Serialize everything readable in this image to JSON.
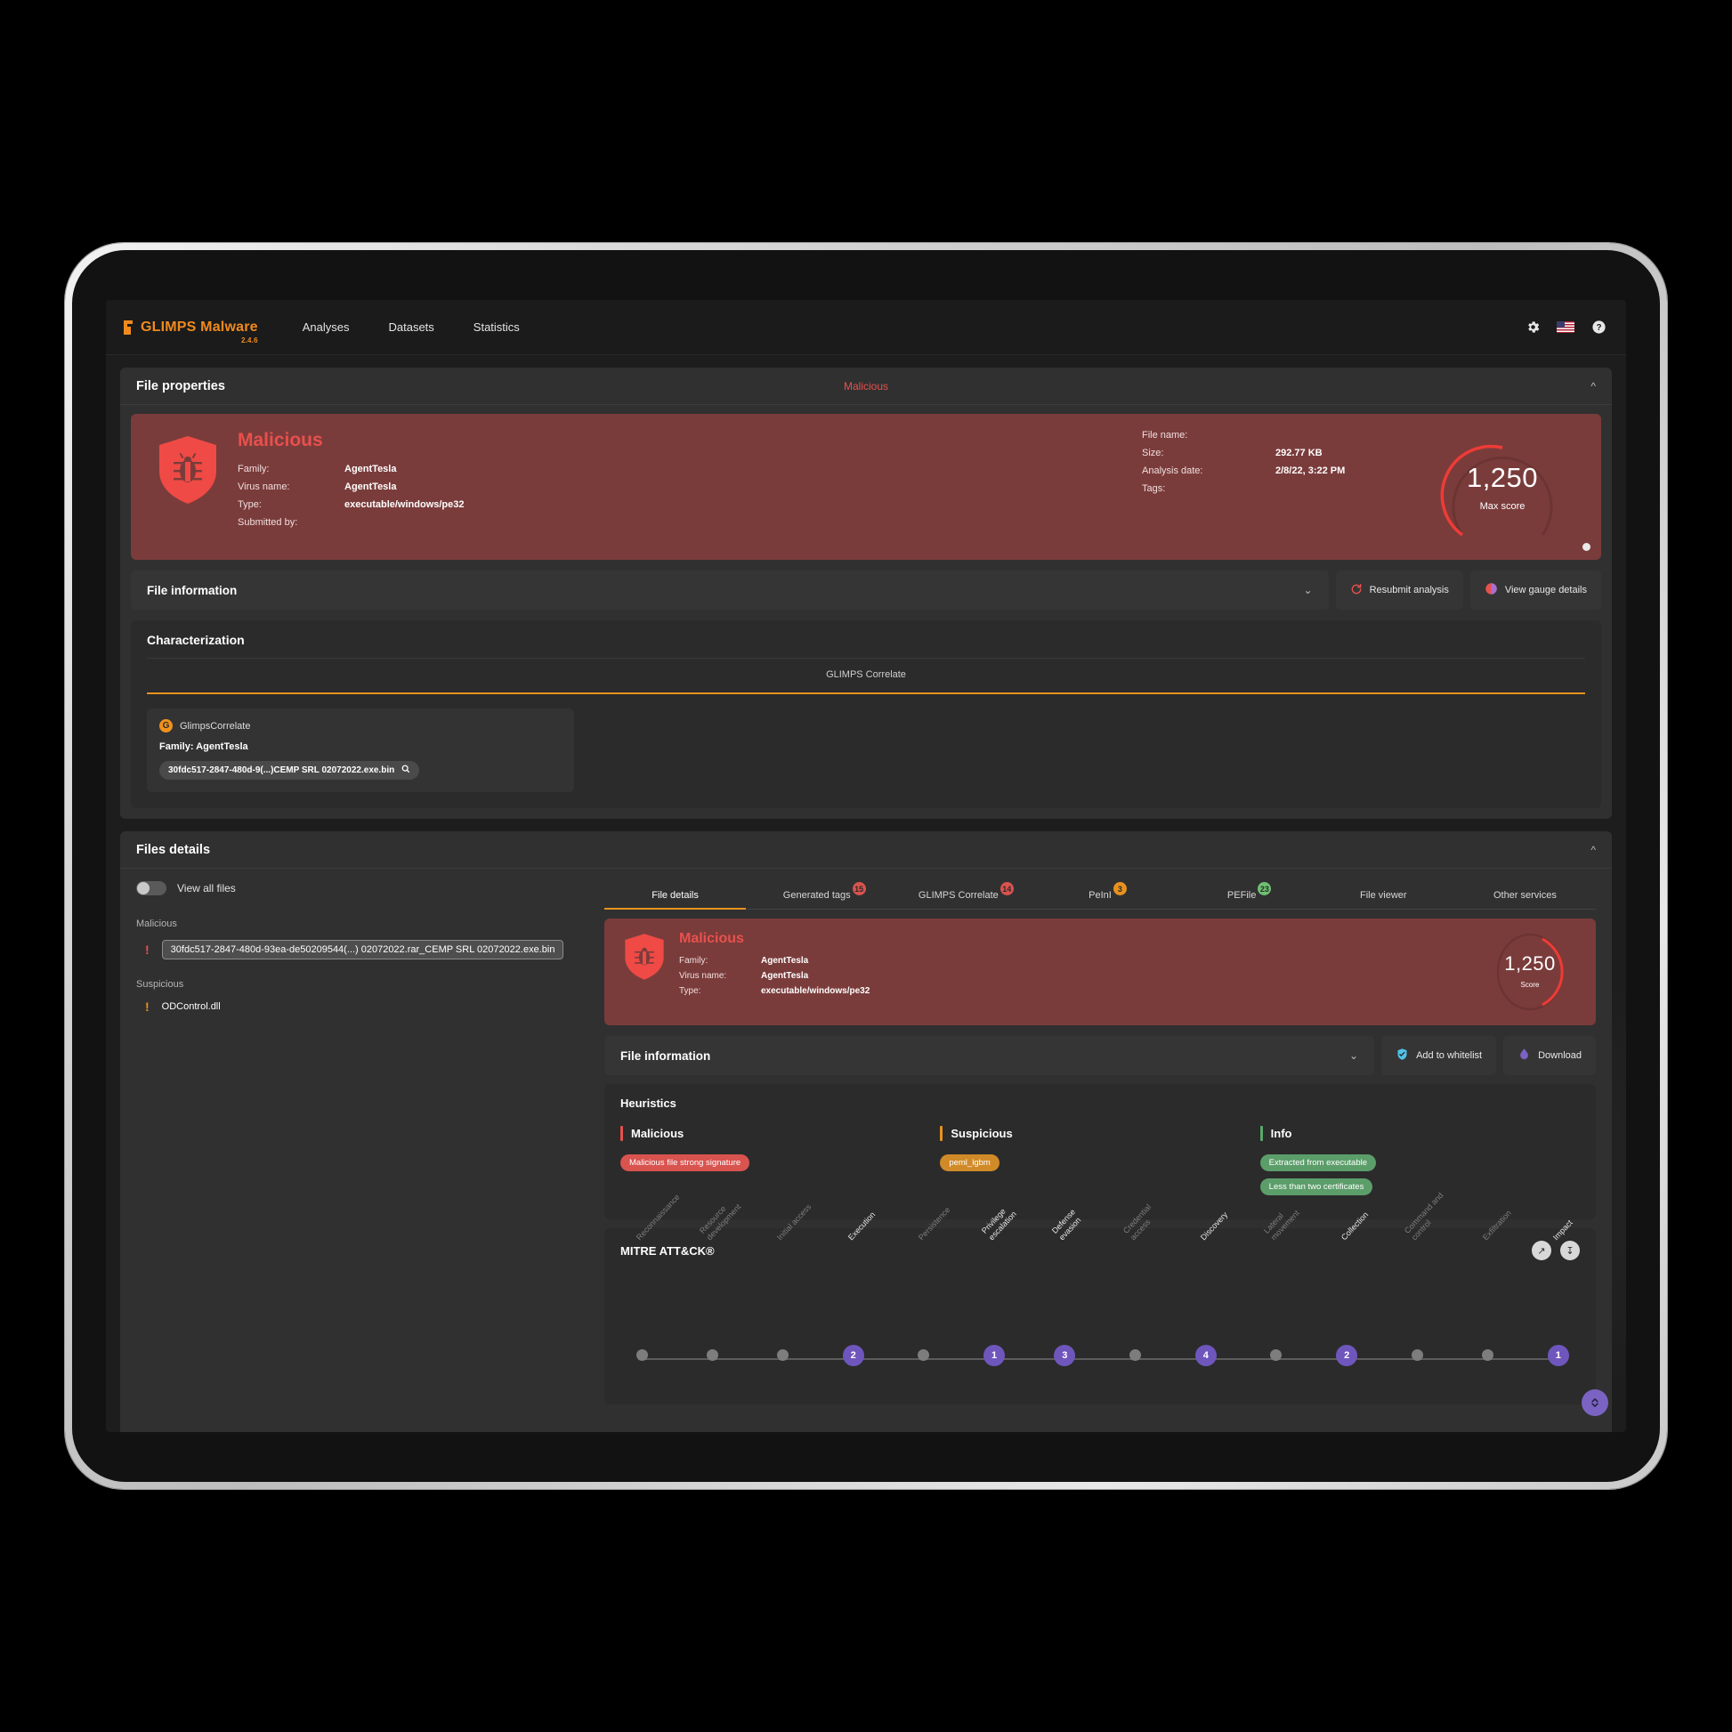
{
  "header": {
    "brand": "GLIMPS Malware",
    "version": "2.4.6",
    "nav": [
      {
        "label": "Analyses"
      },
      {
        "label": "Datasets"
      },
      {
        "label": "Statistics"
      }
    ],
    "icons": {
      "settings": "gear-icon",
      "language": "us-flag-icon",
      "help": "help-icon"
    }
  },
  "file_properties": {
    "title": "File properties",
    "verdict_badge": "Malicious",
    "banner": {
      "verdict": "Malicious",
      "left_fields": [
        {
          "key": "Family:",
          "value": "AgentTesla"
        },
        {
          "key": "Virus name:",
          "value": "AgentTesla"
        },
        {
          "key": "Type:",
          "value": "executable/windows/pe32"
        },
        {
          "key": "Submitted by:",
          "value": ""
        }
      ],
      "right_fields": [
        {
          "key": "File name:",
          "value": ""
        },
        {
          "key": "Size:",
          "value": "292.77 KB"
        },
        {
          "key": "Analysis date:",
          "value": "2/8/22, 3:22 PM"
        },
        {
          "key": "Tags:",
          "value": ""
        }
      ],
      "gauge": {
        "value": "1,250",
        "label": "Max score",
        "color": "#ef3b36",
        "percent": 68
      }
    },
    "file_information": {
      "label": "File information",
      "resubmit_label": "Resubmit analysis",
      "view_gauge_label": "View gauge details"
    },
    "characterization": {
      "title": "Characterization",
      "tab": "GLIMPS Correlate",
      "accent": "#e8921e",
      "correlate_card": {
        "badge": "G",
        "name": "GlimpsCorrelate",
        "family": "Family: AgentTesla",
        "chip": "30fdc517-2847-480d-9(...)CEMP SRL 02072022.exe.bin",
        "chip_icon": "search-icon"
      }
    }
  },
  "files_details": {
    "title": "Files details",
    "view_all_label": "View all files",
    "groups": [
      {
        "label": "Malicious",
        "severity": "malicious",
        "files": [
          {
            "name": "30fdc517-2847-480d-93ea-de50209544(...) 02072022.rar_CEMP SRL 02072022.exe.bin",
            "selected": true
          }
        ]
      },
      {
        "label": "Suspicious",
        "severity": "suspicious",
        "files": [
          {
            "name": "ODControl.dll",
            "selected": false
          }
        ]
      }
    ],
    "tabs": [
      {
        "label": "File details",
        "badge": "",
        "badge_color": "",
        "active": true
      },
      {
        "label": "Generated tags",
        "badge": "15",
        "badge_color": "#d9534f",
        "active": false
      },
      {
        "label": "GLIMPS Correlate",
        "badge": "14",
        "badge_color": "#d9534f",
        "active": false
      },
      {
        "label": "PeInI",
        "badge": "3",
        "badge_color": "#e8921e",
        "active": false
      },
      {
        "label": "PEFile",
        "badge": "23",
        "badge_color": "#6fbf73",
        "active": false
      },
      {
        "label": "File viewer",
        "badge": "",
        "badge_color": "",
        "active": false
      },
      {
        "label": "Other services",
        "badge": "",
        "badge_color": "",
        "active": false
      }
    ],
    "detail_banner": {
      "verdict": "Malicious",
      "fields": [
        {
          "key": "Family:",
          "value": "AgentTesla"
        },
        {
          "key": "Virus name:",
          "value": "AgentTesla"
        },
        {
          "key": "Type:",
          "value": "executable/windows/pe32"
        }
      ],
      "gauge": {
        "value": "1,250",
        "label": "Score",
        "color": "#ef3b36",
        "percent": 68
      }
    },
    "file_information": {
      "label": "File information",
      "whitelist_label": "Add to whitelist",
      "download_label": "Download"
    },
    "heuristics": {
      "title": "Heuristics",
      "columns": [
        {
          "name": "Malicious",
          "color": "#e8504d",
          "tags": [
            {
              "text": "Malicious file strong signature",
              "color": "#d9534f"
            }
          ]
        },
        {
          "name": "Suspicious",
          "color": "#e8921e",
          "tags": [
            {
              "text": "peml_lgbm",
              "color": "#d08a28"
            }
          ]
        },
        {
          "name": "Info",
          "color": "#5aa86b",
          "tags": [
            {
              "text": "Extracted from executable",
              "color": "#5c9e6a"
            },
            {
              "text": "Less than two certificates",
              "color": "#5c9e6a"
            }
          ]
        }
      ]
    },
    "mitre": {
      "title": "MITRE ATT&CK®",
      "icons": [
        "expand-icon",
        "download-icon"
      ],
      "tactics": [
        {
          "name": "Reconnaissance",
          "count": ""
        },
        {
          "name": "Resource\ndevelopment",
          "count": ""
        },
        {
          "name": "Initial access",
          "count": ""
        },
        {
          "name": "Execution",
          "count": "2"
        },
        {
          "name": "Persistence",
          "count": ""
        },
        {
          "name": "Privilege\nescalation",
          "count": "1"
        },
        {
          "name": "Defense\nevasion",
          "count": "3"
        },
        {
          "name": "Credential\naccess",
          "count": ""
        },
        {
          "name": "Discovery",
          "count": "4"
        },
        {
          "name": "Lateral\nmovement",
          "count": ""
        },
        {
          "name": "Collection",
          "count": "2"
        },
        {
          "name": "Command and\ncontrol",
          "count": ""
        },
        {
          "name": "Exfiltration",
          "count": ""
        },
        {
          "name": "Impact",
          "count": "1"
        }
      ]
    },
    "fab_icon": "updown-chevron-icon"
  }
}
